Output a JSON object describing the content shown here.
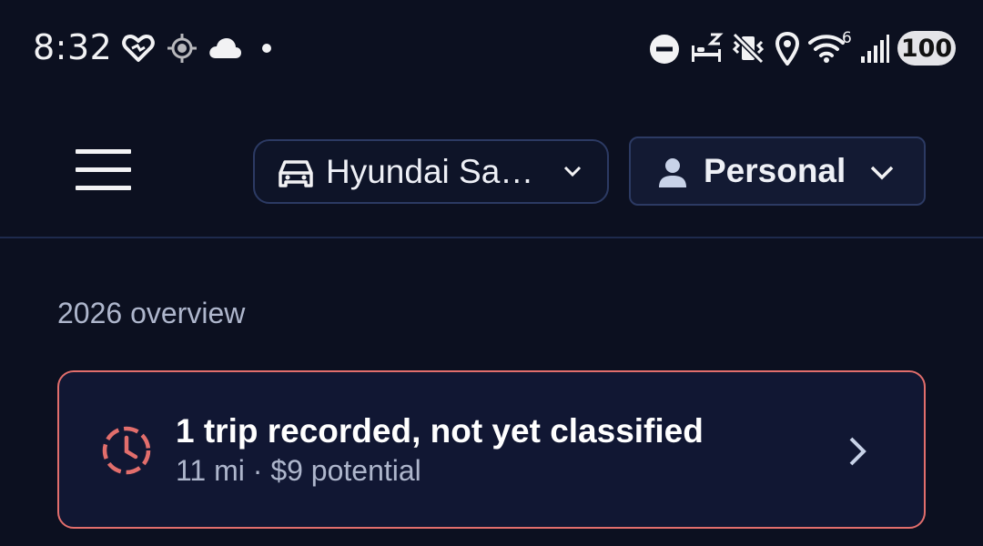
{
  "status_bar": {
    "time": "8:32",
    "battery": "100",
    "wifi_badge": "6",
    "icons": [
      "heart-icon",
      "location-target-icon",
      "cloud-icon",
      "dot-icon",
      "do-not-disturb-icon",
      "bed-icon",
      "vibrate-off-icon",
      "location-pin-icon",
      "wifi-icon",
      "signal-icon"
    ]
  },
  "app_bar": {
    "vehicle_label": "Hyundai Sa…",
    "profile_label": "Personal"
  },
  "overview": {
    "title": "2026 overview"
  },
  "trip_card": {
    "title": "1 trip recorded, not yet classified",
    "subtitle": "11 mi · $9 potential",
    "accent": "#e26e6c"
  },
  "colors": {
    "background": "#0c1020",
    "card": "#111733",
    "border": "#2c3a63",
    "muted_text": "#aeb6cc"
  }
}
